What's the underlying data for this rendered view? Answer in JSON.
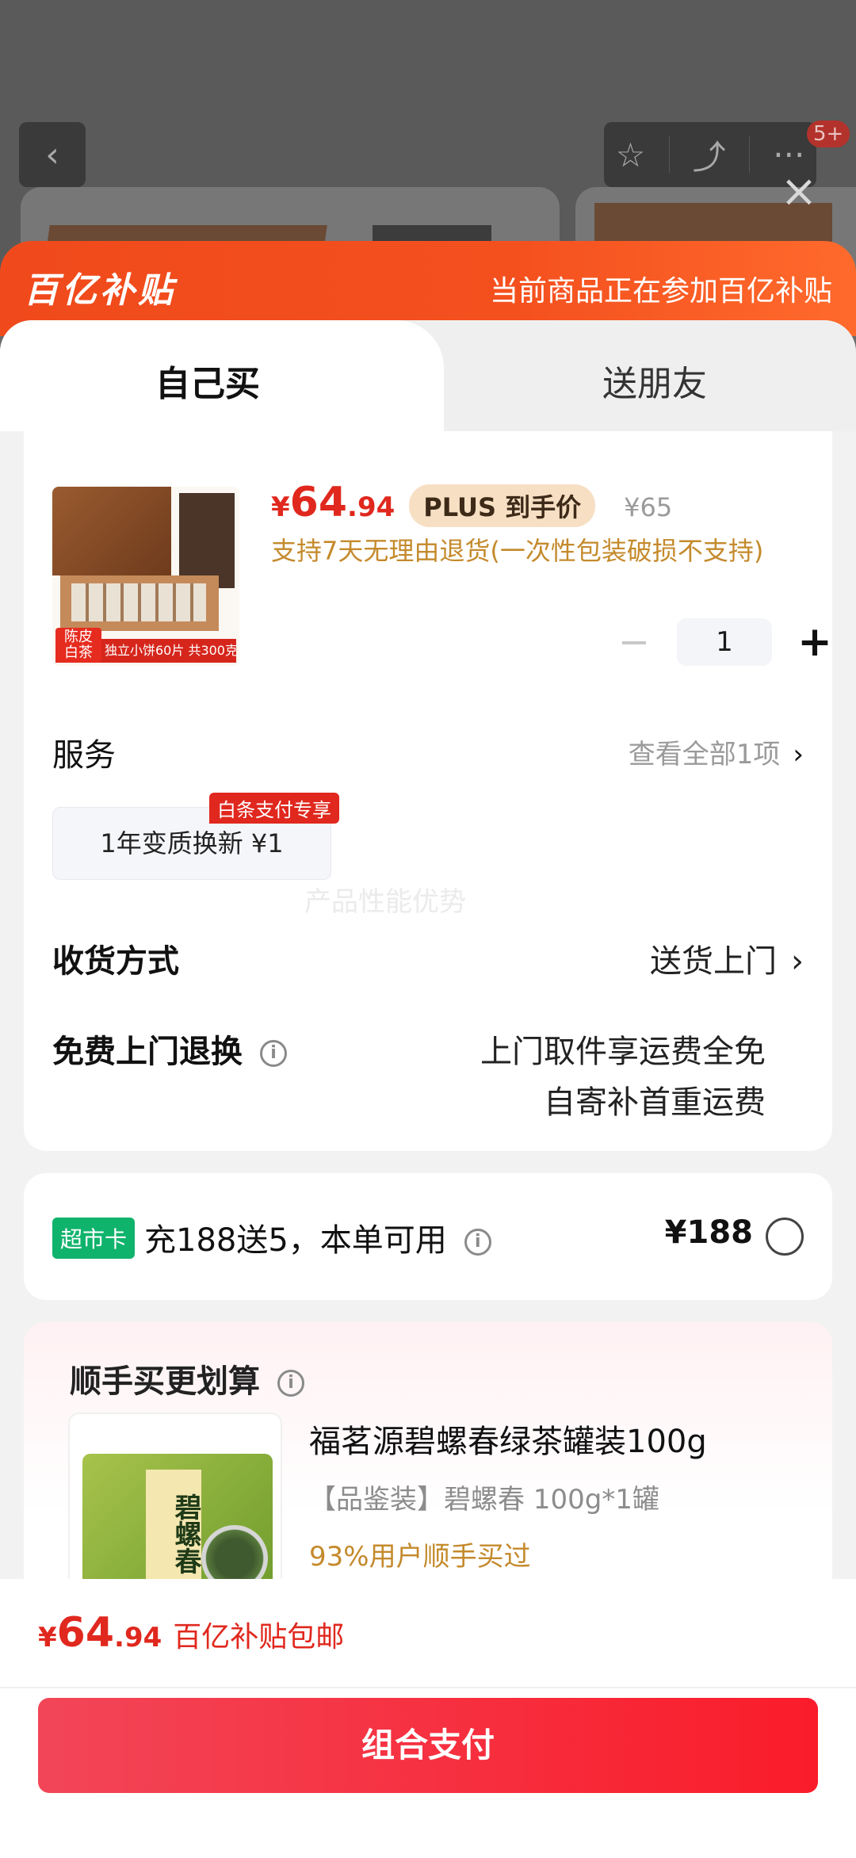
{
  "background": {
    "back_icon": "‹",
    "cart_badge": "5+"
  },
  "close_icon": "×",
  "banner": {
    "logo": "百亿补贴",
    "note": "当前商品正在参加百亿补贴"
  },
  "tabs": [
    {
      "label": "自己买",
      "active": true
    },
    {
      "label": "送朋友",
      "active": false
    }
  ],
  "product": {
    "thumb_tag": "陈皮 白茶",
    "thumb_label": "独立小饼60片 共300克",
    "price_symbol": "¥",
    "price_int": "64",
    "price_dec": ".94",
    "plus_tag": "PLUS 到手价",
    "orig_price": "¥65",
    "return_note": "支持7天无理由退货(一次性包装破损不支持)",
    "quantity": "1",
    "minus": "−",
    "plus": "+"
  },
  "service": {
    "label": "服务",
    "more": "查看全部1项",
    "chevron": "›",
    "chip_badge": "白条支付专享",
    "chip_label": "1年变质换新  ¥1",
    "watermark": "产品性能优势"
  },
  "shipping": {
    "label": "收货方式",
    "value": "送货上门",
    "chevron": "›"
  },
  "free_return": {
    "label": "免费上门退换",
    "line1": "上门取件享运费全免",
    "line2": "自寄补首重运费"
  },
  "market_card": {
    "badge": "超市卡",
    "text": "充188送5，本单可用",
    "price": "¥188"
  },
  "addon": {
    "title": "顺手买更划算",
    "can_label": "碧螺春",
    "name": "福茗源碧螺春绿茶罐装100g",
    "spec": "【品鉴装】碧螺春 100g*1罐",
    "stat": "93%用户顺手买过"
  },
  "footer": {
    "price_symbol": "¥",
    "price_int": "64",
    "price_dec": ".94",
    "note": "百亿补贴包邮",
    "pay_label": "组合支付"
  },
  "colors": {
    "accent": "#e0281e",
    "banner": "#f04a1c",
    "gold": "#c48a2c",
    "green_badge": "#10b36c"
  }
}
